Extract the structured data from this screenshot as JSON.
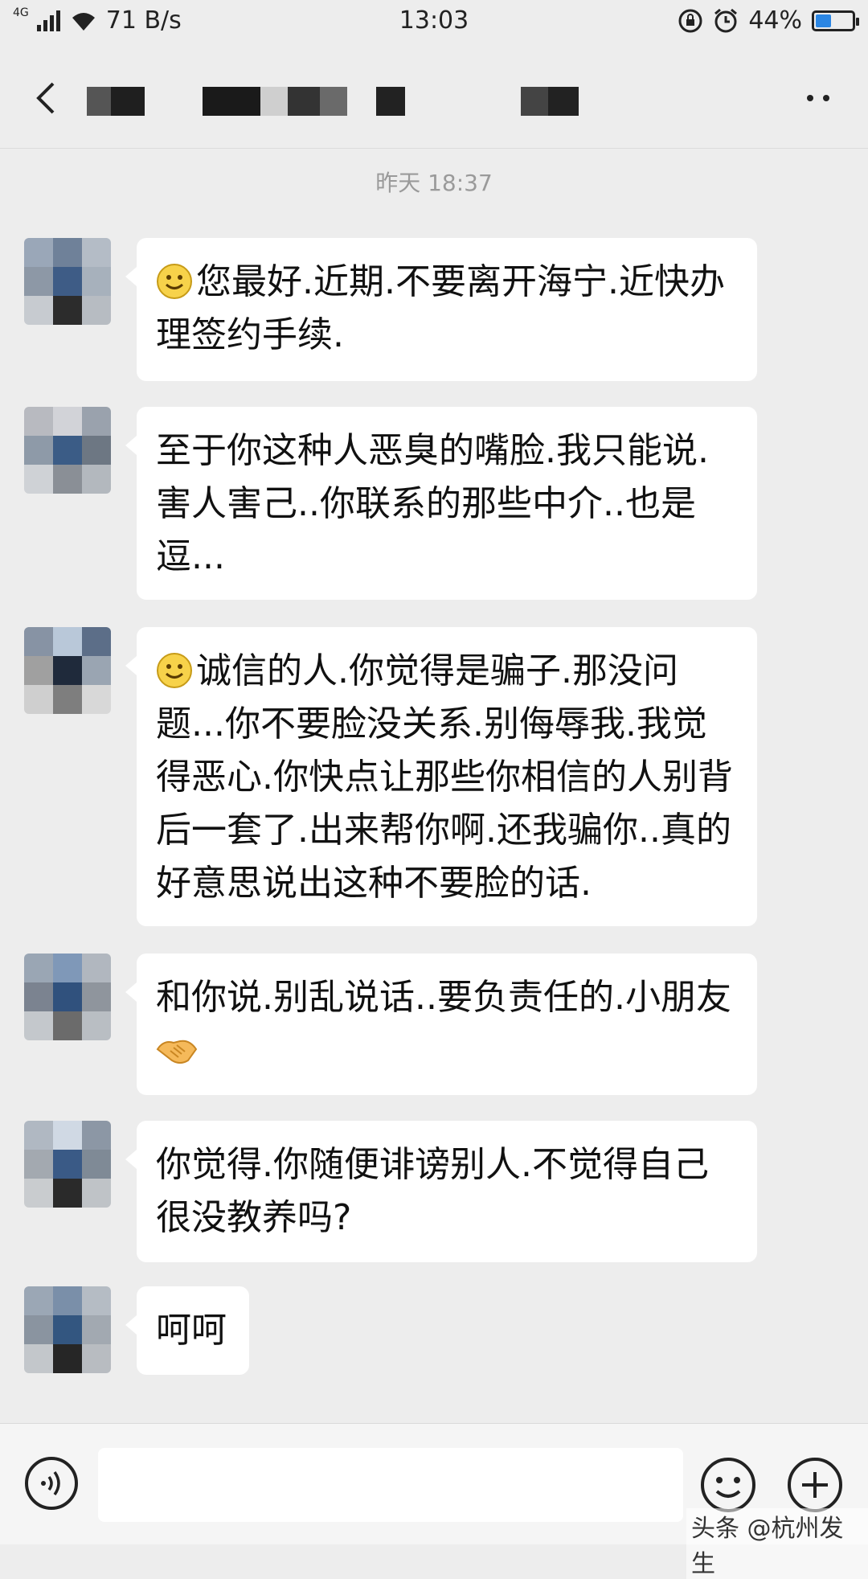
{
  "status_bar": {
    "network": "4G",
    "speed": "71 B/s",
    "time": "13:03",
    "battery": "44%",
    "battery_level": 0.44
  },
  "nav": {
    "back_icon": "chevron-left-icon",
    "more_icon": "more-dots-icon"
  },
  "chat": {
    "timestamp": "昨天 18:37",
    "messages": [
      {
        "text": "您最好.近期.不要离开海宁.近快办理签约手续.",
        "emoji_prefix": "smile"
      },
      {
        "text": "至于你这种人恶臭的嘴脸.我只能说.害人害己..你联系的那些中介..也是逗..."
      },
      {
        "text": "诚信的人.你觉得是骗子.那没问题...你不要脸没关系.别侮辱我.我觉得恶心.你快点让那些你相信的人别背后一套了.出来帮你啊.还我骗你..真的好意思说出这种不要脸的话.",
        "emoji_prefix": "smile"
      },
      {
        "text": "和你说.别乱说话..要负责任的.小朋友",
        "emoji_suffix": "handshake"
      },
      {
        "text": "你觉得.你随便诽谤别人.不觉得自己很没教养吗?"
      },
      {
        "text": "呵呵"
      }
    ]
  },
  "input_bar": {
    "voice_icon": "voice-icon",
    "emoji_icon": "emoji-icon",
    "plus_icon": "plus-icon",
    "input_value": ""
  },
  "watermark": "头条 @杭州发生",
  "colors": {
    "background": "#ededed",
    "bubble": "#ffffff",
    "battery_fill": "#2b86e3"
  }
}
